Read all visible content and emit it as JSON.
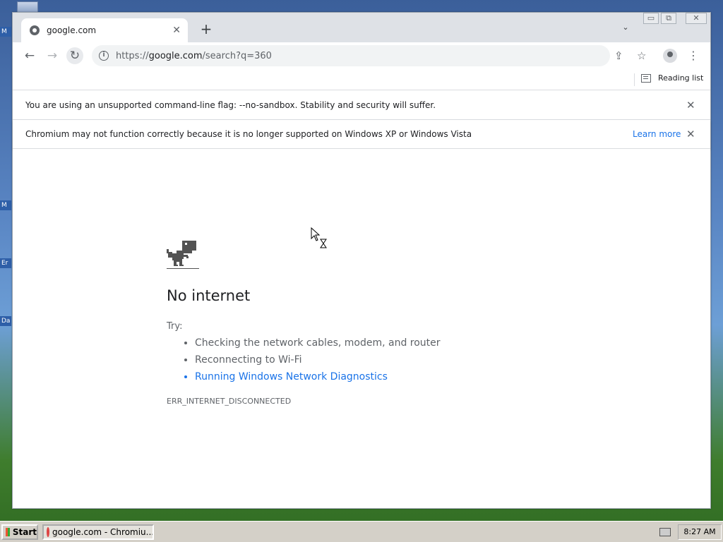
{
  "browser": {
    "tab_title": "google.com",
    "url_host": "google.com",
    "url_scheme": "https://",
    "url_path": "/search?q=360",
    "reading_list_label": "Reading list"
  },
  "infobars": [
    {
      "message": "You are using an unsupported command-line flag: --no-sandbox. Stability and security will suffer."
    },
    {
      "message": "Chromium may not function correctly because it is no longer supported on Windows XP or Windows Vista",
      "link": "Learn more"
    }
  ],
  "error_page": {
    "title": "No internet",
    "try_label": "Try:",
    "suggestions": [
      "Checking the network cables, modem, and router",
      "Reconnecting to Wi-Fi",
      "Running Windows Network Diagnostics"
    ],
    "error_code": "ERR_INTERNET_DISCONNECTED"
  },
  "desktop_icons": [
    "M",
    "M",
    "Er",
    "Da"
  ],
  "taskbar": {
    "start_label": "Start",
    "task_label": "google.com - Chromiu...",
    "clock": "8:27 AM"
  },
  "colors": {
    "link": "#1a73e8",
    "tabstrip": "#dee1e6"
  }
}
